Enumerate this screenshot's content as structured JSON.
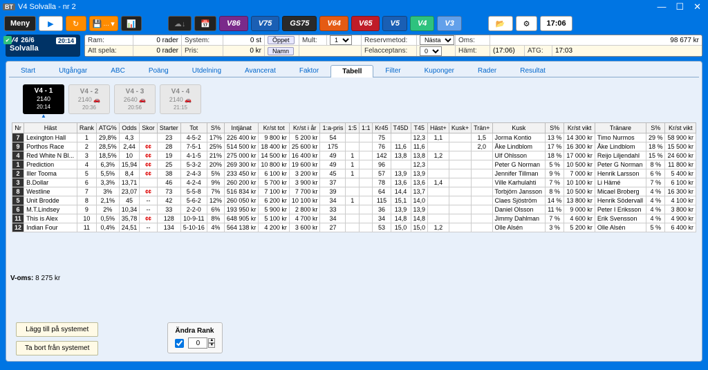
{
  "window": {
    "title": "V4 Solvalla - nr 2"
  },
  "toolbar": {
    "meny": "Meny",
    "games": [
      "V86",
      "V75",
      "GS75",
      "V64",
      "V65",
      "V5",
      "V4",
      "V3"
    ],
    "time": "17:06"
  },
  "leftinfo": {
    "game": "V4",
    "date": "26/6",
    "badge": "20:14",
    "track": "Solvalla"
  },
  "info": {
    "row1": {
      "ram_l": "Ram:",
      "ram_v": "0 rader",
      "system_l": "System:",
      "system_v": "0 st",
      "oppet": "Öppet",
      "mult_l": "Mult:",
      "mult_v": "1",
      "reserv_l": "Reservmetod:",
      "reserv_v": "Nästa",
      "oms_l": "Oms:",
      "oms_v": "98 677 kr"
    },
    "row2": {
      "att_l": "Att spela:",
      "att_v": "0 rader",
      "pris_l": "Pris:",
      "pris_v": "0 kr",
      "namn": "Namn",
      "fel_l": "Felacceptans:",
      "fel_v": "0",
      "hamt_l": "Hämt:",
      "hamt_v": "(17:06)",
      "atg_l": "ATG:",
      "atg_v": "17:03"
    }
  },
  "tabs": [
    "Start",
    "Utgångar",
    "ABC",
    "Poäng",
    "Utdelning",
    "Avancerat",
    "Faktor",
    "Tabell",
    "Filter",
    "Kuponger",
    "Rader",
    "Resultat"
  ],
  "active_tab": "Tabell",
  "chips": [
    {
      "t1": "V4 - 1",
      "t2": "2140",
      "t3": "20:14",
      "cls": "a"
    },
    {
      "t1": "V4 - 2",
      "t2": "2140",
      "t3": "20:36",
      "cls": "b",
      "car": true
    },
    {
      "t1": "V4 - 3",
      "t2": "2640",
      "t3": "20:56",
      "cls": "c",
      "car": true
    },
    {
      "t1": "V4 - 4",
      "t2": "2140",
      "t3": "21:15",
      "cls": "d",
      "car": true
    }
  ],
  "columns": [
    "Nr",
    "Häst",
    "Rank",
    "ATG%",
    "Odds",
    "Skor",
    "Starter",
    "Tot",
    "S%",
    "Intjänat",
    "Kr/st tot",
    "Kr/st i år",
    "1:a-pris",
    "1:5",
    "1:1",
    "Kr45",
    "T45D",
    "T45",
    "Häst+",
    "Kusk+",
    "Trän+",
    "Kusk",
    "S%",
    "Kr/st vikt",
    "Tränare",
    "S%",
    "Kr/st vikt"
  ],
  "rows": [
    {
      "nr": "7",
      "hast": "Lexington Hall",
      "rank": "1",
      "atg": "29,8%",
      "odds": "4,3",
      "skor": "",
      "start": "23",
      "tot": "4-5-2",
      "sp": "17%",
      "intj": "226 400 kr",
      "krtot": "9 800 kr",
      "krar": "5 200 kr",
      "pris": "54",
      "a15": "",
      "a11": "",
      "kr45": "75",
      "t45d": "",
      "t45": "12,3",
      "hastp": "1,1",
      "kuskp": "",
      "tranp": "1,5",
      "kusk": "Jorma Kontio",
      "ks": "13 %",
      "kv": "14 300 kr",
      "tran": "Timo Nurmos",
      "ts": "29 %",
      "tv": "58 900 kr"
    },
    {
      "nr": "9",
      "hast": "Porthos Race",
      "rank": "2",
      "atg": "28,5%",
      "odds": "2,44",
      "skor": "CC",
      "start": "28",
      "tot": "7-5-1",
      "sp": "25%",
      "intj": "514 500 kr",
      "krtot": "18 400 kr",
      "krar": "25 600 kr",
      "pris": "175",
      "a15": "",
      "a11": "",
      "kr45": "76",
      "t45d": "11,6",
      "t45": "11,6",
      "hastp": "",
      "kuskp": "",
      "tranp": "2,0",
      "kusk": "Åke Lindblom",
      "ks": "17 %",
      "kv": "16 300 kr",
      "tran": "Åke Lindblom",
      "ts": "18 %",
      "tv": "15 500 kr"
    },
    {
      "nr": "4",
      "hast": "Red White N Bl...",
      "rank": "3",
      "atg": "18,5%",
      "odds": "10",
      "skor": "CC",
      "start": "19",
      "tot": "4-1-5",
      "sp": "21%",
      "intj": "275 000 kr",
      "krtot": "14 500 kr",
      "krar": "16 400 kr",
      "pris": "49",
      "a15": "1",
      "a11": "",
      "kr45": "142",
      "t45d": "13,8",
      "t45": "13,8",
      "hastp": "1,2",
      "kuskp": "",
      "tranp": "",
      "kusk": "Ulf Ohlsson",
      "ks": "18 %",
      "kv": "17 000 kr",
      "tran": "Reijo Liljendahl",
      "ts": "15 %",
      "tv": "24 600 kr"
    },
    {
      "nr": "1",
      "hast": "Prediction",
      "rank": "4",
      "atg": "6,3%",
      "odds": "15,94",
      "skor": "CC",
      "start": "25",
      "tot": "5-3-2",
      "sp": "20%",
      "intj": "269 300 kr",
      "krtot": "10 800 kr",
      "krar": "19 600 kr",
      "pris": "49",
      "a15": "1",
      "a11": "",
      "kr45": "96",
      "t45d": "",
      "t45": "12,3",
      "hastp": "",
      "kuskp": "",
      "tranp": "",
      "kusk": "Peter G Norman",
      "ks": "5 %",
      "kv": "10 500 kr",
      "tran": "Peter G Norman",
      "ts": "8 %",
      "tv": "11 800 kr"
    },
    {
      "nr": "2",
      "hast": "Iller Tooma",
      "rank": "5",
      "atg": "5,5%",
      "odds": "8,4",
      "skor": "CC",
      "start": "38",
      "tot": "2-4-3",
      "sp": "5%",
      "intj": "233 450 kr",
      "krtot": "6 100 kr",
      "krar": "3 200 kr",
      "pris": "45",
      "a15": "1",
      "a11": "",
      "kr45": "57",
      "t45d": "13,9",
      "t45": "13,9",
      "hastp": "",
      "kuskp": "",
      "tranp": "",
      "kusk": "Jennifer Tillman",
      "ks": "9 %",
      "kv": "7 000 kr",
      "tran": "Henrik Larsson",
      "ts": "6 %",
      "tv": "5 400 kr"
    },
    {
      "nr": "3",
      "hast": "B.Dollar",
      "rank": "6",
      "atg": "3,3%",
      "odds": "13,71",
      "skor": "",
      "start": "46",
      "tot": "4-2-4",
      "sp": "9%",
      "intj": "260 200 kr",
      "krtot": "5 700 kr",
      "krar": "3 900 kr",
      "pris": "37",
      "a15": "",
      "a11": "",
      "kr45": "78",
      "t45d": "13,6",
      "t45": "13,6",
      "hastp": "1,4",
      "kuskp": "",
      "tranp": "",
      "kusk": "Ville Karhulahti",
      "ks": "7 %",
      "kv": "10 100 kr",
      "tran": "Li Hämé",
      "ts": "7 %",
      "tv": "6 100 kr"
    },
    {
      "nr": "8",
      "hast": "Westline",
      "rank": "7",
      "atg": "3%",
      "odds": "23,07",
      "skor": "CC",
      "start": "73",
      "tot": "5-5-8",
      "sp": "7%",
      "intj": "516 834 kr",
      "krtot": "7 100 kr",
      "krar": "7 700 kr",
      "pris": "39",
      "a15": "",
      "a11": "",
      "kr45": "64",
      "t45d": "14,4",
      "t45": "13,7",
      "hastp": "",
      "kuskp": "",
      "tranp": "",
      "kusk": "Torbjörn Jansson",
      "ks": "8 %",
      "kv": "10 500 kr",
      "tran": "Micael Broberg",
      "ts": "4 %",
      "tv": "16 300 kr"
    },
    {
      "nr": "5",
      "hast": "Unit Brodde",
      "rank": "8",
      "atg": "2,1%",
      "odds": "45",
      "skor": "--",
      "start": "42",
      "tot": "5-6-2",
      "sp": "12%",
      "intj": "260 050 kr",
      "krtot": "6 200 kr",
      "krar": "10 100 kr",
      "pris": "34",
      "a15": "1",
      "a11": "",
      "kr45": "115",
      "t45d": "15,1",
      "t45": "14,0",
      "hastp": "",
      "kuskp": "",
      "tranp": "",
      "kusk": "Claes Sjöström",
      "ks": "14 %",
      "kv": "13 800 kr",
      "tran": "Henrik Södervall",
      "ts": "4 %",
      "tv": "4 100 kr"
    },
    {
      "nr": "6",
      "hast": "M.T.Lindsey",
      "rank": "9",
      "atg": "2%",
      "odds": "10,34",
      "skor": "--",
      "start": "33",
      "tot": "2-2-0",
      "sp": "6%",
      "intj": "193 950 kr",
      "krtot": "5 900 kr",
      "krar": "2 800 kr",
      "pris": "33",
      "a15": "",
      "a11": "",
      "kr45": "36",
      "t45d": "13,9",
      "t45": "13,9",
      "hastp": "",
      "kuskp": "",
      "tranp": "",
      "kusk": "Daniel Olsson",
      "ks": "11 %",
      "kv": "9 000 kr",
      "tran": "Peter I Eriksson",
      "ts": "4 %",
      "tv": "3 800 kr"
    },
    {
      "nr": "11",
      "hast": "This is Alex",
      "rank": "10",
      "atg": "0,5%",
      "odds": "35,78",
      "skor": "CC",
      "start": "128",
      "tot": "10-9-11",
      "sp": "8%",
      "intj": "648 905 kr",
      "krtot": "5 100 kr",
      "krar": "4 700 kr",
      "pris": "34",
      "a15": "",
      "a11": "",
      "kr45": "34",
      "t45d": "14,8",
      "t45": "14,8",
      "hastp": "",
      "kuskp": "",
      "tranp": "",
      "kusk": "Jimmy Dahlman",
      "ks": "7 %",
      "kv": "4 600 kr",
      "tran": "Erik Svensson",
      "ts": "4 %",
      "tv": "4 900 kr"
    },
    {
      "nr": "12",
      "hast": "Indian Four",
      "rank": "11",
      "atg": "0,4%",
      "odds": "24,51",
      "skor": "--",
      "start": "134",
      "tot": "5-10-16",
      "sp": "4%",
      "intj": "564 138 kr",
      "krtot": "4 200 kr",
      "krar": "3 600 kr",
      "pris": "27",
      "a15": "",
      "a11": "",
      "kr45": "53",
      "t45d": "15,0",
      "t45": "15,0",
      "hastp": "1,2",
      "kuskp": "",
      "tranp": "",
      "kusk": "Olle Alsén",
      "ks": "3 %",
      "kv": "5 200 kr",
      "tran": "Olle Alsén",
      "ts": "5 %",
      "tv": "6 400 kr"
    }
  ],
  "voms_l": "V-oms:",
  "voms_v": "8 275 kr",
  "btn_add": "Lägg till på systemet",
  "btn_del": "Ta bort från systemet",
  "rank_hdr": "Ändra Rank",
  "rank_val": "0"
}
